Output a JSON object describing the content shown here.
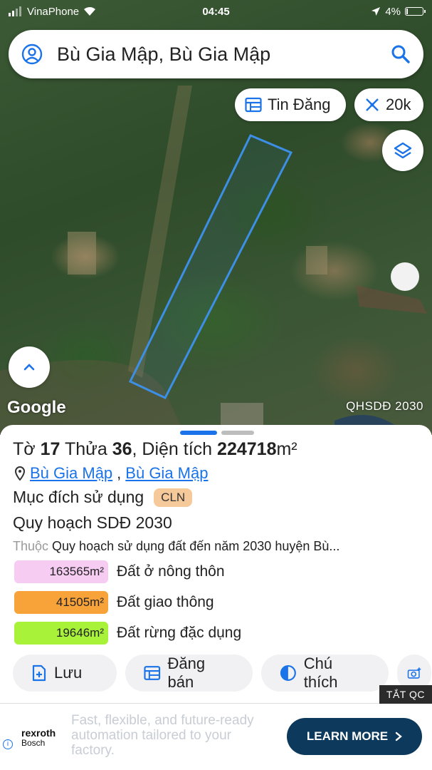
{
  "status_bar": {
    "carrier": "VinaPhone",
    "time": "04:45",
    "battery": "4%",
    "battery_level": 0.04
  },
  "search": {
    "query": "Bù Gia Mập, Bù Gia Mập"
  },
  "map_controls": {
    "listings_label": "Tin Đăng",
    "zoom_label": "20k"
  },
  "map": {
    "attribution": "Google",
    "layer_label": "QHSDĐ 2030"
  },
  "parcel": {
    "sheet_label": "Tờ",
    "sheet_no": "17",
    "plot_label": "Thửa",
    "plot_no": "36",
    "area_label": ", Diện tích",
    "area_value": "224718",
    "area_unit": "m²",
    "location_commune": "Bù Gia Mập",
    "location_separator": ",",
    "location_district": "Bù Gia Mập",
    "purpose_label": "Mục đích sử dụng",
    "purpose_code": "CLN",
    "plan_title": "Quy hoạch SDĐ 2030",
    "plan_prefix": "Thuộc",
    "plan_desc": "Quy hoạch sử dụng đất đến năm 2030 huyện Bù..."
  },
  "land_uses": [
    {
      "area": "163565m²",
      "label": "Đất ở nông thôn",
      "color": "#f6ccf3"
    },
    {
      "area": "41505m²",
      "label": "Đất giao thông",
      "color": "#f8a23a"
    },
    {
      "area": "19646m²",
      "label": "Đất rừng đặc dụng",
      "color": "#a8f23a"
    }
  ],
  "actions": {
    "save": "Lưu",
    "post_sale": "Đăng bán",
    "legend": "Chú thích"
  },
  "ad": {
    "close_label": "TẮT QC",
    "brand": "rexroth",
    "brand_sub": "Bosch",
    "text": "Fast, flexible, and future-ready automation tailored to your factory.",
    "cta": "LEARN MORE"
  },
  "colors": {
    "accent": "#1a73e8",
    "parcel_outline": "#3d8fe6",
    "handle_active": "#1a73e8",
    "handle_inactive": "#bdbdbd"
  }
}
